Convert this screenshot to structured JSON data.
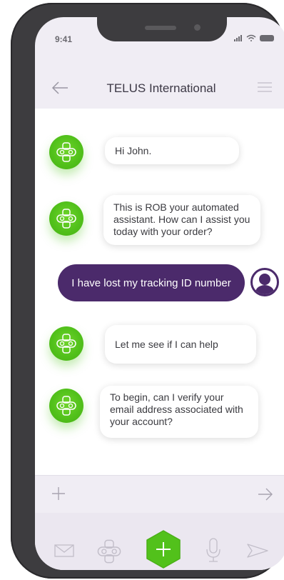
{
  "status_bar": {
    "time": "9:41"
  },
  "header": {
    "title": "TELUS International"
  },
  "messages": [
    {
      "sender": "bot",
      "text": "Hi John."
    },
    {
      "sender": "bot",
      "text": "This is ROB your automated assistant. How can I assist you today with your order?"
    },
    {
      "sender": "user",
      "text": "I have lost my tracking ID number"
    },
    {
      "sender": "bot",
      "text": "Let me see if I can help"
    },
    {
      "sender": "bot",
      "text": "To begin, can I verify your email address associated with your account?"
    }
  ],
  "colors": {
    "accent_green": "#52c11b",
    "user_bubble": "#4b2a6b",
    "screen_bg": "#f0edf4"
  },
  "icons": {
    "back": "arrow-left-icon",
    "menu": "hamburger-menu-icon",
    "bot": "robot-face-icon",
    "user": "user-silhouette-icon",
    "add": "plus-icon",
    "send_arrow": "arrow-right-icon",
    "mail": "mail-icon",
    "robot": "robot-icon",
    "compose": "plus-hexagon-icon",
    "mic": "microphone-icon",
    "send": "send-icon"
  }
}
